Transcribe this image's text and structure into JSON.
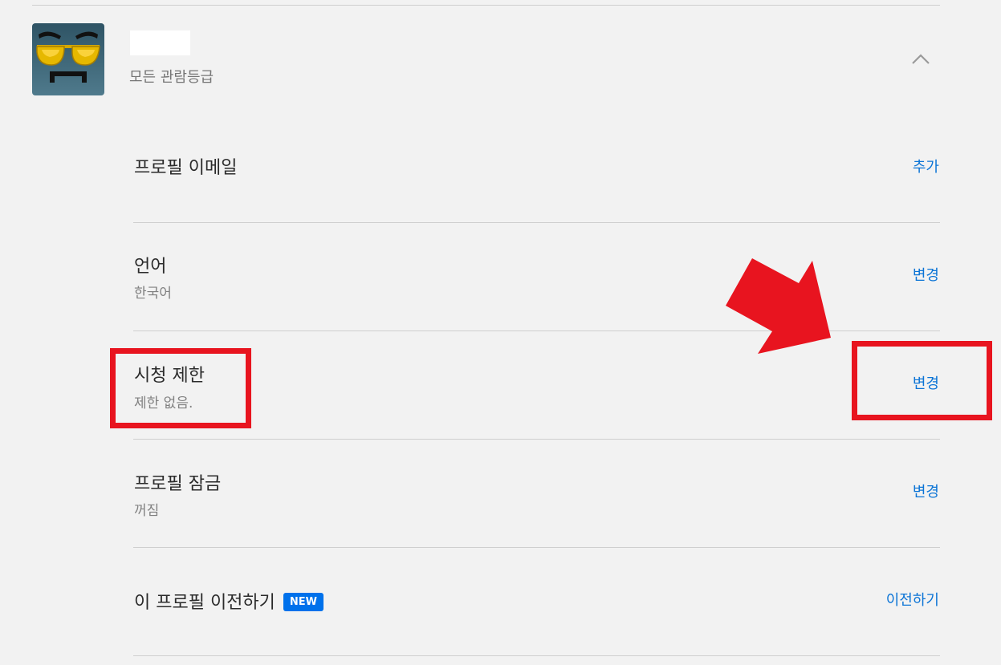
{
  "profile": {
    "rating_label": "모든 관람등급"
  },
  "settings": {
    "email": {
      "title": "프로필 이메일",
      "action": "추가"
    },
    "language": {
      "title": "언어",
      "value": "한국어",
      "action": "변경"
    },
    "restriction": {
      "title": "시청 제한",
      "value": "제한 없음.",
      "action": "변경"
    },
    "lock": {
      "title": "프로필 잠금",
      "value": "꺼짐",
      "action": "변경"
    },
    "transfer": {
      "title": "이 프로필 이전하기",
      "badge": "NEW",
      "action": "이전하기"
    }
  },
  "colors": {
    "accent": "#0b74d6",
    "highlight": "#e8141f",
    "badge": "#0071eb"
  },
  "icons": {
    "avatar": "sunglasses-face-avatar",
    "collapse": "chevron-up-icon",
    "annotation": "red-arrow-icon"
  }
}
